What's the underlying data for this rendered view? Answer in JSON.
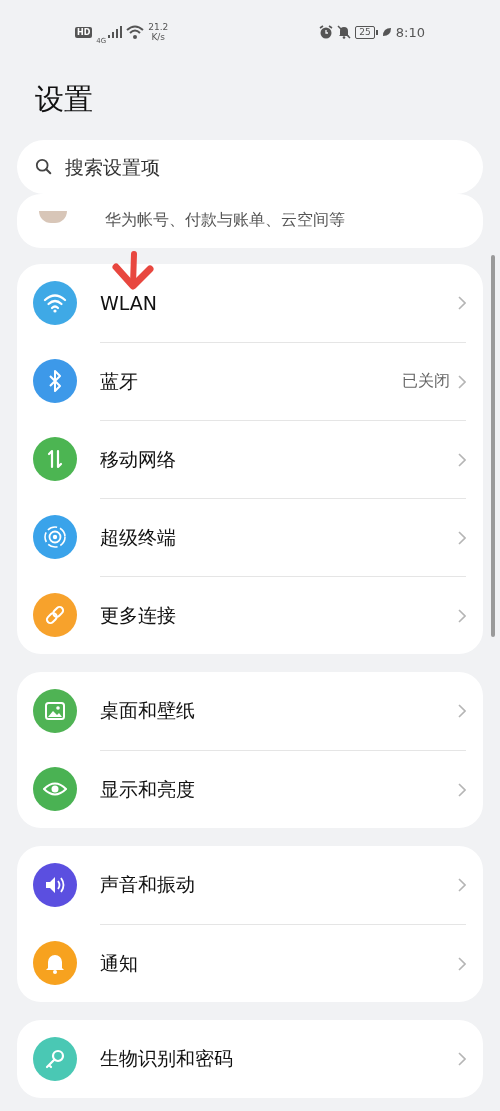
{
  "status_bar": {
    "hd": "HD",
    "network": "4G",
    "speed": "21.2",
    "speed_unit": "K/s",
    "battery": "25",
    "time": "8:10"
  },
  "title": "设置",
  "search": {
    "placeholder": "搜索设置项"
  },
  "account": {
    "subtitle": "华为帐号、付款与账单、云空间等"
  },
  "groups": [
    {
      "items": [
        {
          "kind": "wifi",
          "color": "#3fa9e6",
          "label": "WLAN"
        },
        {
          "kind": "bluetooth",
          "color": "#3d99e9",
          "label": "蓝牙",
          "value": "已关闭"
        },
        {
          "kind": "mobile",
          "color": "#4cb552",
          "label": "移动网络"
        },
        {
          "kind": "terminal",
          "color": "#3aa3ea",
          "label": "超级终端"
        },
        {
          "kind": "link",
          "color": "#f7a22c",
          "label": "更多连接"
        }
      ]
    },
    {
      "items": [
        {
          "kind": "image",
          "color": "#4fb354",
          "label": "桌面和壁纸"
        },
        {
          "kind": "eye",
          "color": "#4ab253",
          "label": "显示和亮度"
        }
      ]
    },
    {
      "items": [
        {
          "kind": "sound",
          "color": "#5b4fe0",
          "label": "声音和振动"
        },
        {
          "kind": "bell",
          "color": "#f7a21f",
          "label": "通知"
        }
      ]
    },
    {
      "items": [
        {
          "kind": "key",
          "color": "#4ac8b4",
          "label": "生物识别和密码"
        }
      ]
    }
  ]
}
